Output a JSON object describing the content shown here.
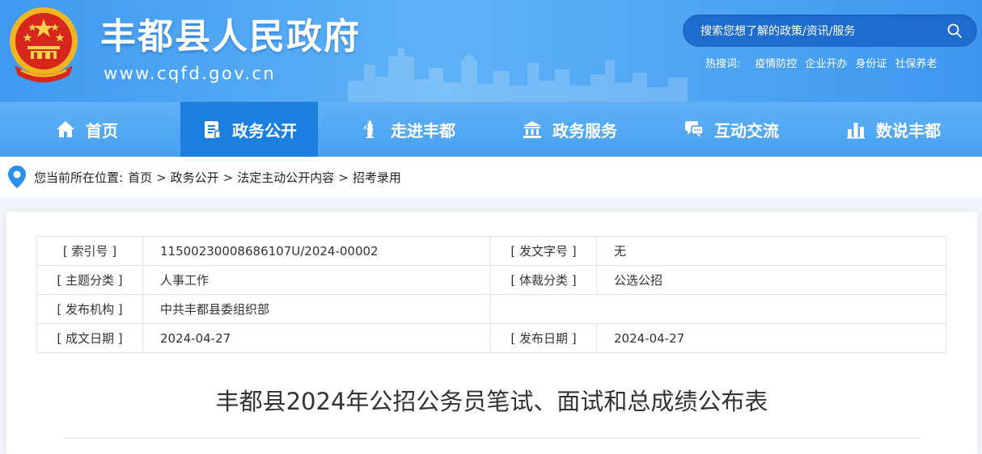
{
  "header": {
    "title": "丰都县人民政府",
    "url": "www.cqfd.gov.cn",
    "emblem_icon": "national-emblem-icon",
    "search": {
      "placeholder": "搜索您想了解的政策/资讯/服务",
      "icon": "search-icon"
    },
    "hot_label": "热搜词:",
    "hot_words": [
      "疫情防控",
      "企业开办",
      "身份证",
      "社保养老"
    ]
  },
  "nav": {
    "items": [
      {
        "label": "首页",
        "icon": "home-icon",
        "active": false
      },
      {
        "label": "政务公开",
        "icon": "document-icon",
        "active": true
      },
      {
        "label": "走进丰都",
        "icon": "landmark-statue-icon",
        "active": false
      },
      {
        "label": "政务服务",
        "icon": "government-building-icon",
        "active": false
      },
      {
        "label": "互动交流",
        "icon": "chat-icon",
        "active": false
      },
      {
        "label": "数说丰都",
        "icon": "bar-chart-icon",
        "active": false
      }
    ],
    "active_color": "#1b7fe0"
  },
  "breadcrumb": {
    "prefix": "您当前所在位置:",
    "items": [
      "首页",
      "政务公开",
      "法定主动公开内容",
      "招考录用"
    ],
    "separator": ">",
    "icon": "location-pin-icon"
  },
  "meta": {
    "index_label": "[ 索引号 ]",
    "index_value": "11500230008686107U/2024-00002",
    "docno_label": "[ 发文字号 ]",
    "docno_value": "无",
    "topic_label": "[ 主题分类 ]",
    "topic_value": "人事工作",
    "genre_label": "[ 体裁分类 ]",
    "genre_value": "公选公招",
    "org_label": "[ 发布机构 ]",
    "org_value": "中共丰都县委组织部",
    "created_label": "[ 成文日期 ]",
    "created_value": "2024-04-27",
    "published_label": "[ 发布日期 ]",
    "published_value": "2024-04-27"
  },
  "document": {
    "title": "丰都县2024年公招公务员笔试、面试和总成绩公布表"
  },
  "colors": {
    "header_blue": "#4ba3f3",
    "search_bg": "#1f6ccf",
    "nav_active": "#1b7fe0",
    "pin_blue": "#2a8ff0"
  }
}
